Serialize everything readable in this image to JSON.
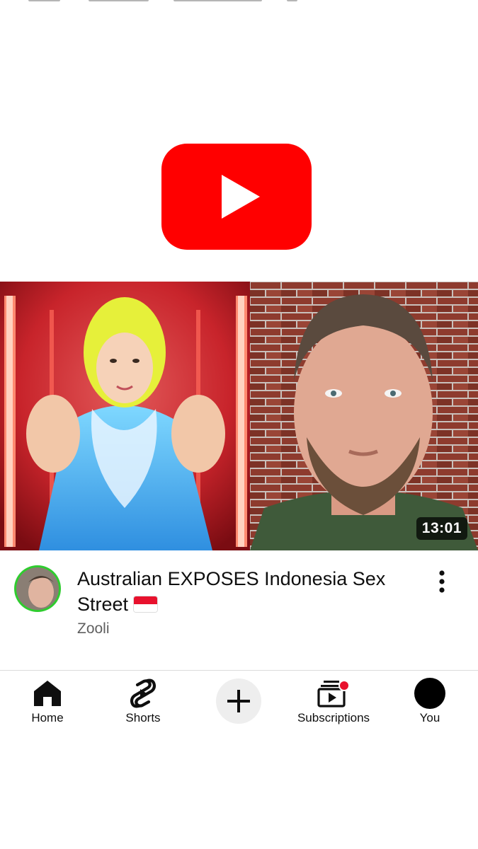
{
  "video": {
    "title": "Australian EXPOSES Indonesia Sex Street",
    "flag_icon": "indonesia-flag-icon",
    "channel": "Zooli",
    "duration": "13:01"
  },
  "bottom_nav": {
    "home": "Home",
    "shorts": "Shorts",
    "create_icon": "plus-icon",
    "subscriptions": "Subscriptions",
    "you": "You"
  },
  "colors": {
    "youtube_red": "#ff0000",
    "avatar_ring": "#2fcc2f",
    "notification_dot": "#e8112d"
  }
}
